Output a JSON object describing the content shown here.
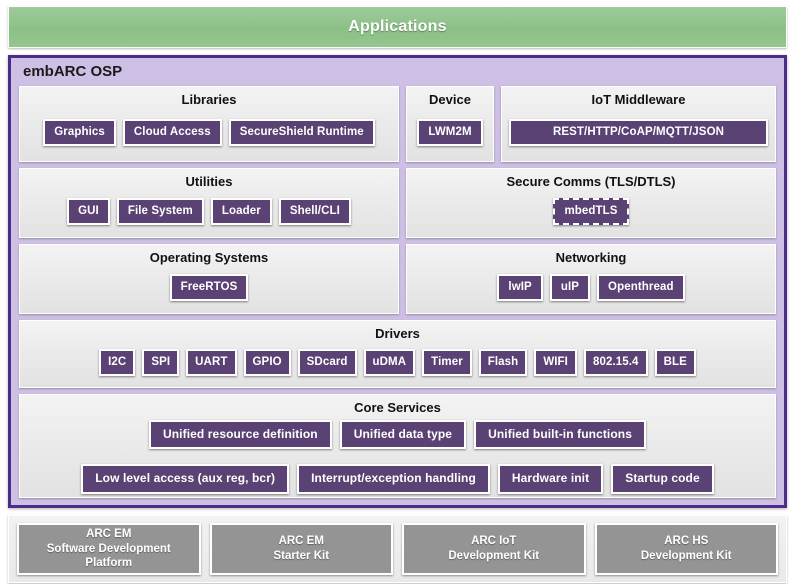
{
  "applications": {
    "label": "Applications",
    "color": "#8cc087"
  },
  "osp": {
    "title": "embARC OSP",
    "frame_color": "#4b2d87",
    "fill_color": "#cec0e4",
    "chip_color": "#5a4274"
  },
  "sections": {
    "libraries": {
      "title": "Libraries",
      "items": [
        "Graphics",
        "Cloud Access",
        "SecureShield Runtime"
      ]
    },
    "device": {
      "title": "Device",
      "items": [
        "LWM2M"
      ]
    },
    "iot_middleware": {
      "title": "IoT Middleware",
      "items": [
        "REST/HTTP/CoAP/MQTT/JSON"
      ]
    },
    "utilities": {
      "title": "Utilities",
      "items": [
        "GUI",
        "File System",
        "Loader",
        "Shell/CLI"
      ]
    },
    "secure_comms": {
      "title": "Secure Comms  (TLS/DTLS)",
      "items": [
        "mbedTLS"
      ]
    },
    "operating_systems": {
      "title": "Operating Systems",
      "items": [
        "FreeRTOS"
      ]
    },
    "networking": {
      "title": "Networking",
      "items": [
        "lwIP",
        "uIP",
        "Openthread"
      ]
    },
    "drivers": {
      "title": "Drivers",
      "items": [
        "I2C",
        "SPI",
        "UART",
        "GPIO",
        "SDcard",
        "uDMA",
        "Timer",
        "Flash",
        "WIFI",
        "802.15.4",
        "BLE"
      ]
    },
    "core_services": {
      "title": "Core Services",
      "row1": [
        "Unified resource definition",
        "Unified data type",
        "Unified built-in functions"
      ],
      "row2": [
        "Low level access (aux reg, bcr)",
        "Interrupt/exception handling",
        "Hardware init",
        "Startup code"
      ]
    }
  },
  "kits": {
    "color": "#949494",
    "items": [
      {
        "line1": "ARC EM",
        "line2": "Software Development Platform"
      },
      {
        "line1": "ARC EM",
        "line2": "Starter Kit"
      },
      {
        "line1": "ARC IoT",
        "line2": "Development Kit"
      },
      {
        "line1": "ARC HS",
        "line2": "Development Kit"
      }
    ]
  }
}
